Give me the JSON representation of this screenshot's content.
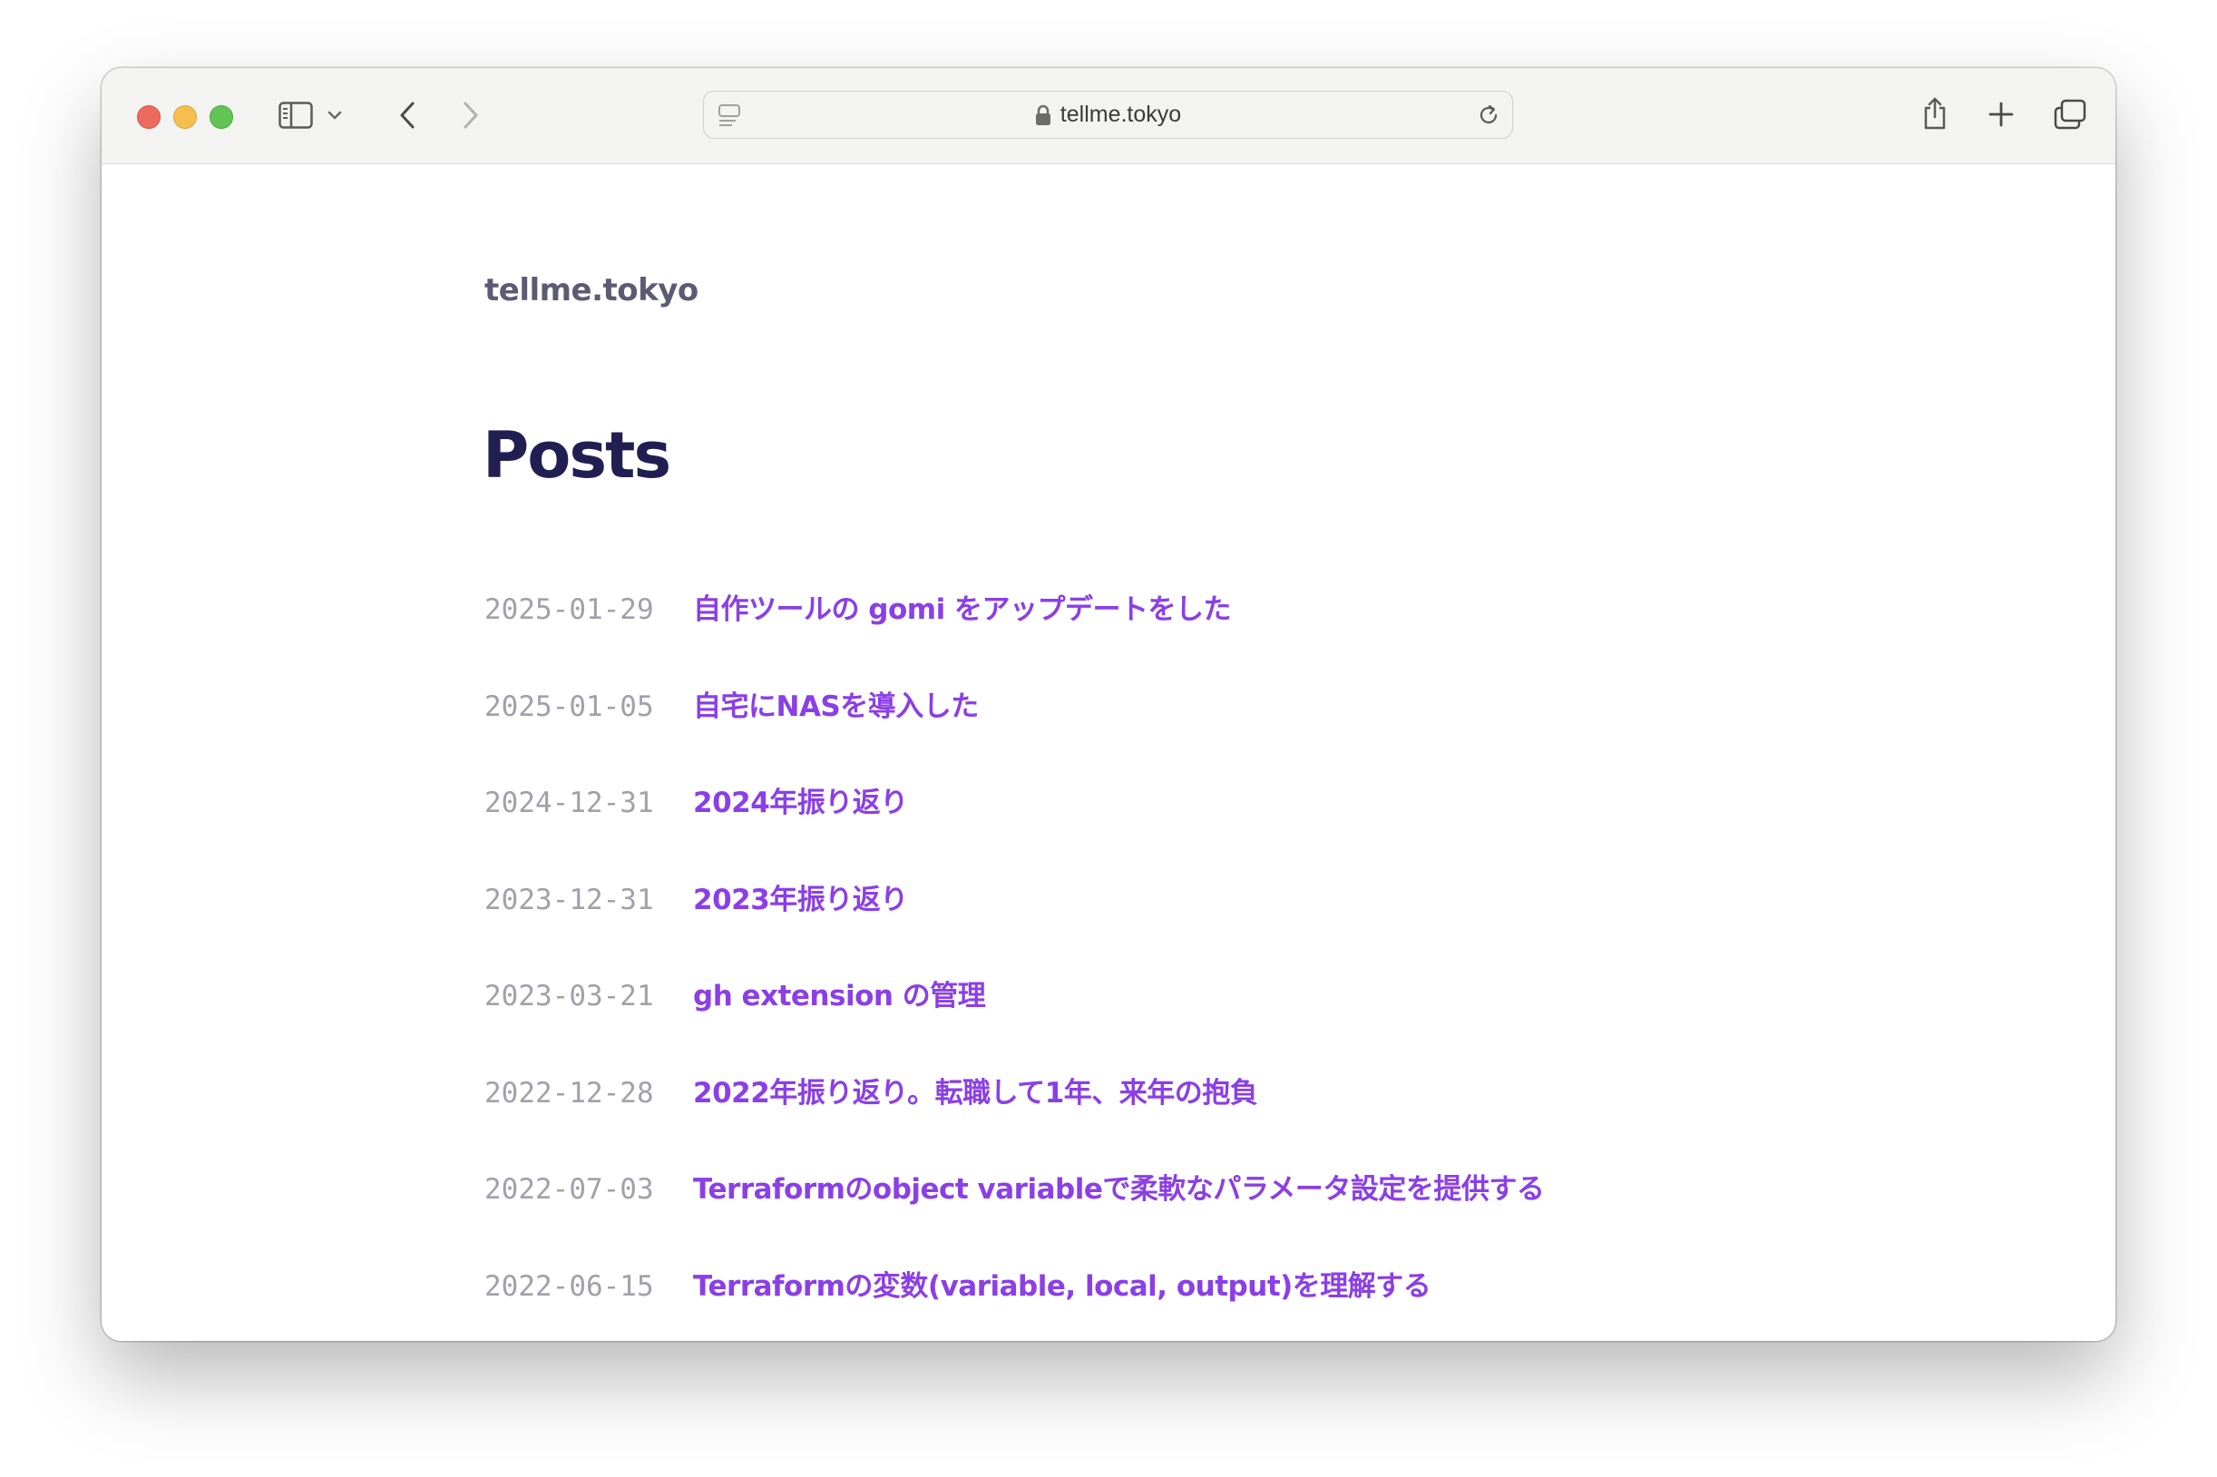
{
  "browser": {
    "url": "tellme.tokyo",
    "icons": {
      "sidebar": "sidebar-icon",
      "sidebar_menu": "chevron-down-icon",
      "back": "back-icon",
      "forward": "forward-icon",
      "page_menu": "page-menu-icon",
      "lock": "lock-icon",
      "reload": "reload-icon",
      "share": "share-icon",
      "new_tab": "plus-icon",
      "tabs": "tab-overview-icon"
    },
    "colors": {
      "close": "#ed6a5e",
      "minimize": "#f5bf4f",
      "zoom": "#61c454"
    }
  },
  "site": {
    "title": "tellme.tokyo"
  },
  "page": {
    "heading": "Posts"
  },
  "posts": [
    {
      "date": "2025-01-29",
      "title": "自作ツールの gomi をアップデートをした"
    },
    {
      "date": "2025-01-05",
      "title": "自宅にNASを導入した"
    },
    {
      "date": "2024-12-31",
      "title": "2024年振り返り"
    },
    {
      "date": "2023-12-31",
      "title": "2023年振り返り"
    },
    {
      "date": "2023-03-21",
      "title": "gh extension の管理"
    },
    {
      "date": "2022-12-28",
      "title": "2022年振り返り。転職して1年、来年の抱負"
    },
    {
      "date": "2022-07-03",
      "title": "Terraformのobject variableで柔軟なパラメータ設定を提供する"
    },
    {
      "date": "2022-06-15",
      "title": "Terraformの変数(variable, local, output)を理解する"
    }
  ],
  "theme": {
    "link_color": "#8b3fe6",
    "heading_color": "#211f52",
    "date_color": "#a1a0ab"
  }
}
